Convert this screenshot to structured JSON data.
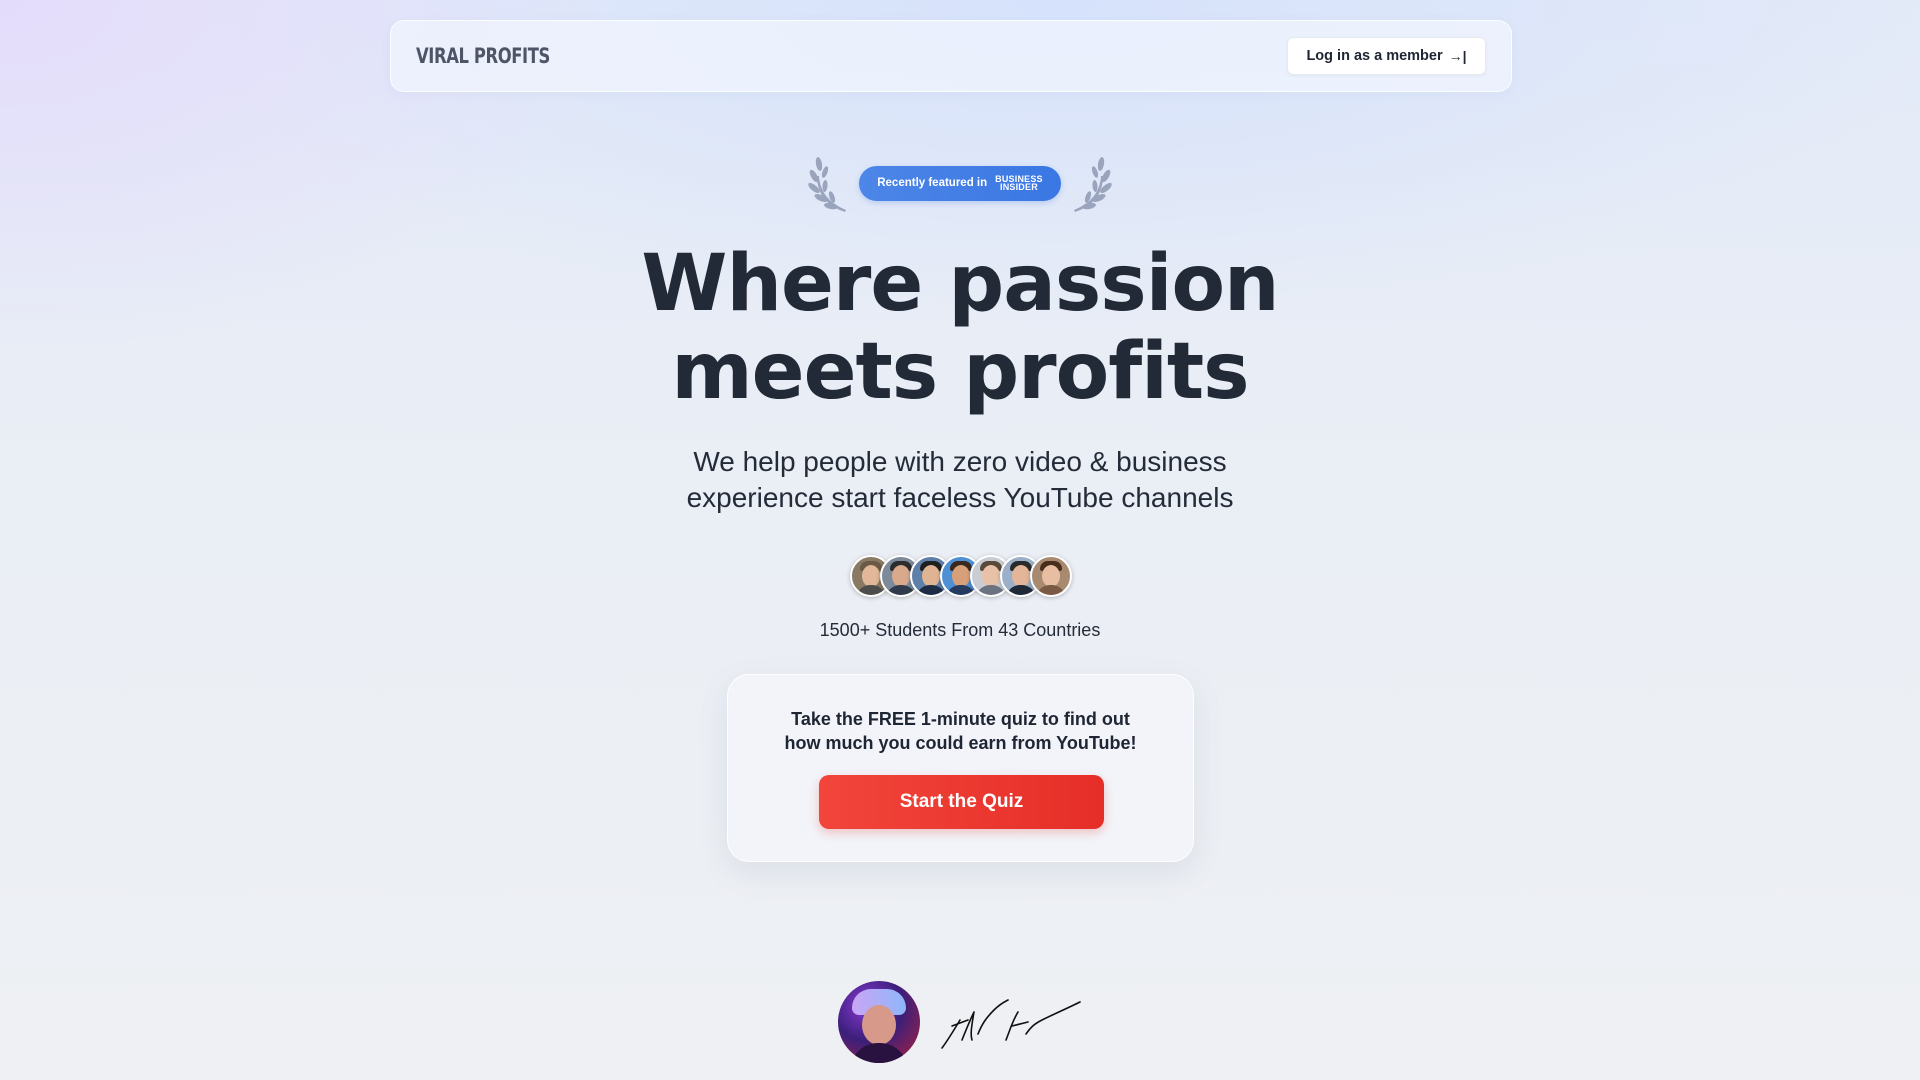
{
  "nav": {
    "logo": "VIRAL PROFITS",
    "login_label": "Log in as a member",
    "login_icon": "→|"
  },
  "featured": {
    "prefix": "Recently featured in",
    "outlet_line1": "BUSINESS",
    "outlet_line2": "INSIDER"
  },
  "hero": {
    "headline_line1": "Where passion",
    "headline_line2": "meets profits",
    "subhead_line1": "We help people with zero video & business",
    "subhead_line2": "experience start faceless YouTube channels"
  },
  "students": {
    "text": "1500+ Students From 43 Countries",
    "avatar_count": 7
  },
  "quiz": {
    "text_line1": "Take the FREE 1-minute quiz to find out",
    "text_line2": "how much you could earn from YouTube!",
    "button_label": "Start the Quiz"
  },
  "colors": {
    "accent_red": "#e52e27",
    "badge_blue": "#3a77e3",
    "text_dark": "#232a37"
  }
}
